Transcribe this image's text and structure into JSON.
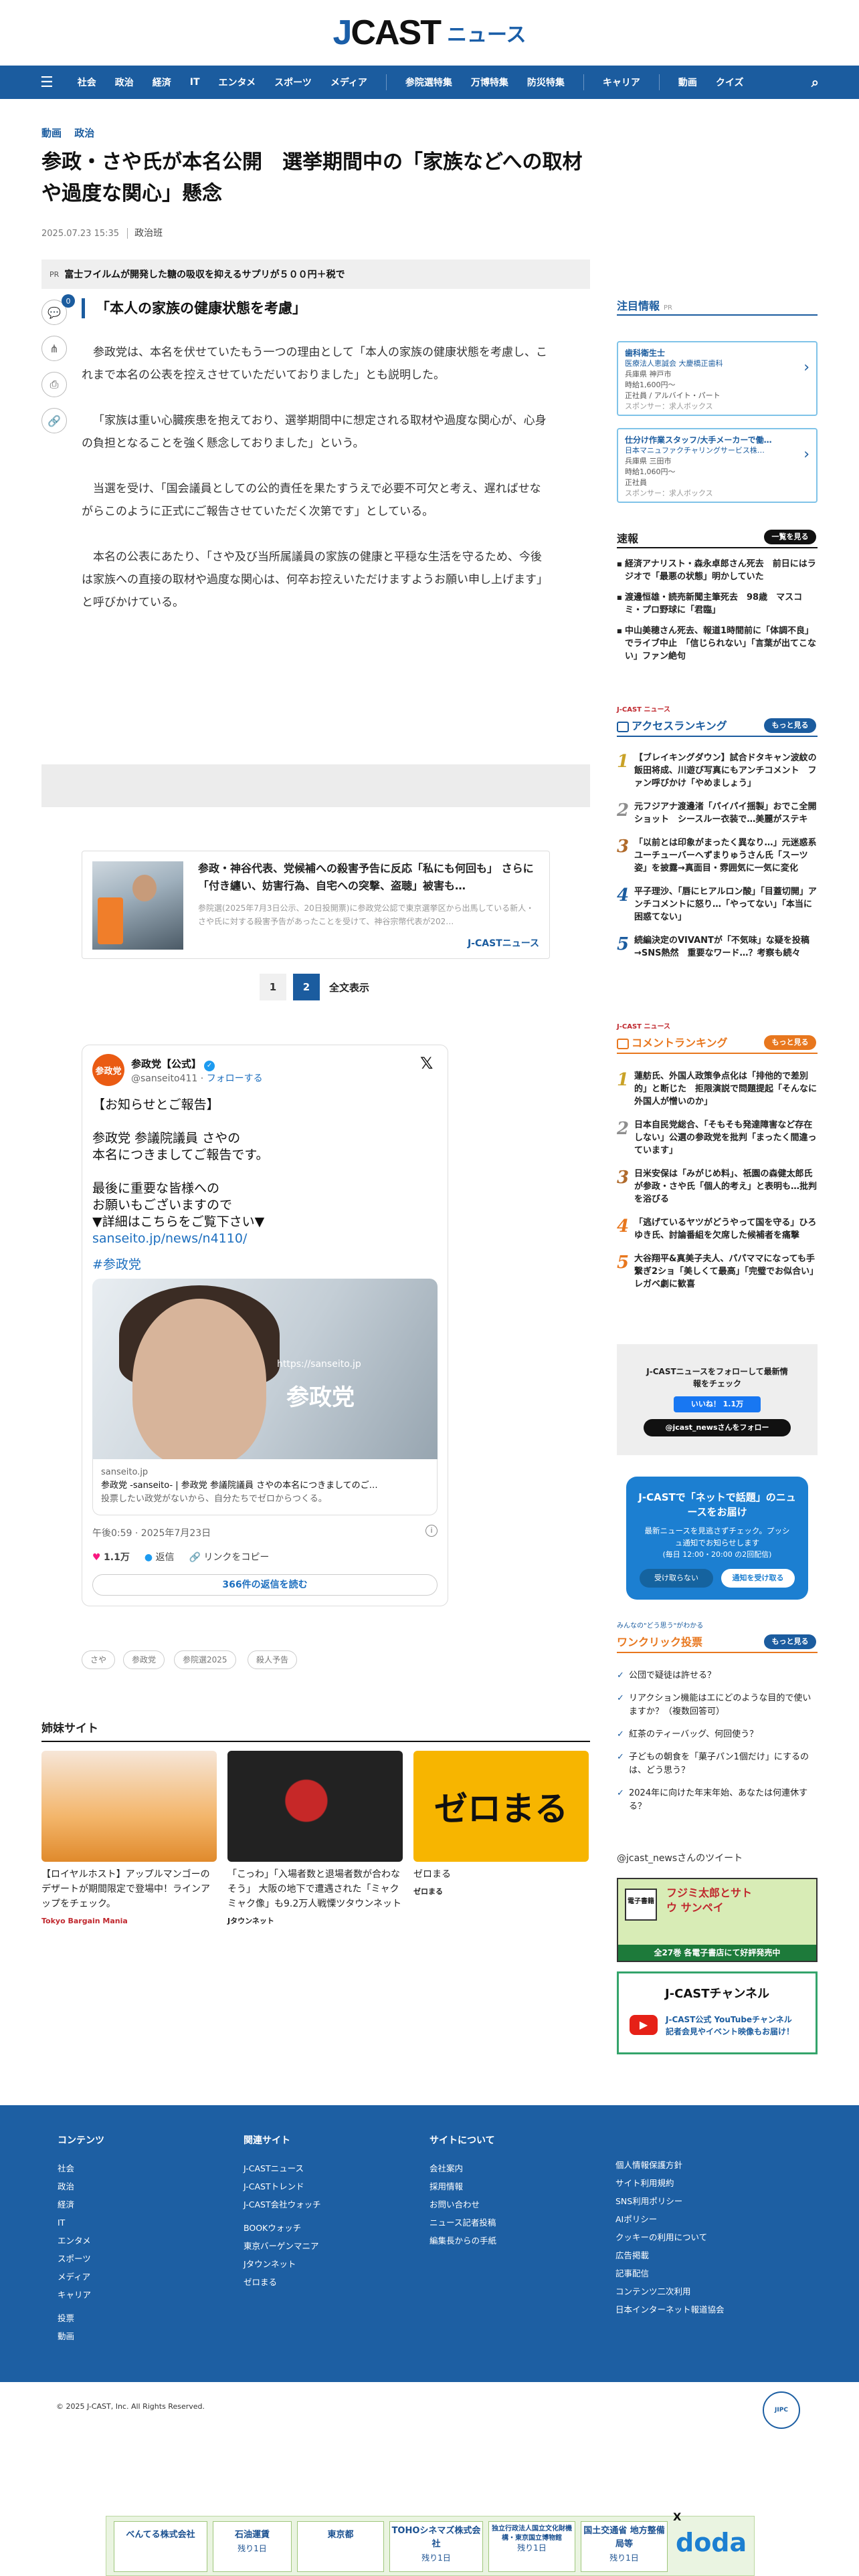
{
  "header": {
    "logo_j": "J",
    "logo_cast": "CAST",
    "logo_news": "ニュース"
  },
  "nav": {
    "items": [
      "社会",
      "政治",
      "経済",
      "IT",
      "エンタメ",
      "スポーツ",
      "メディア",
      "参院選特集",
      "万博特集",
      "防災特集",
      "キャリア",
      "動画",
      "クイズ"
    ]
  },
  "article": {
    "categories": [
      "動画",
      "政治"
    ],
    "title": "参政・さや氏が本名公開　選挙期間中の「家族などへの取材や過度な関心」懸念",
    "date": "2025.07.23 15:35",
    "byline": "政治班",
    "pr_label": "PR",
    "pr_text": "富士フイルムが開発した糖の吸収を抑えるサプリが５００円＋税で",
    "share_count": "0",
    "heading": "「本人の家族の健康状態を考慮」",
    "paragraphs": [
      "参政党は、本名を伏せていたもう一つの理由として「本人の家族の健康状態を考慮し、これまで本名の公表を控えさせていただいておりました」とも説明した。",
      "「家族は重い心臓疾患を抱えており、選挙期間中に想定される取材や過度な関心が、心身の負担となることを強く懸念しておりました」という。",
      "当選を受け、「国会議員としての公的責任を果たすうえで必要不可欠と考え、遅ればせながらこのように正式にご報告させていただく次第です」としている。",
      "本名の公表にあたり、「さや及び当所属議員の家族の健康と平穏な生活を守るため、今後は家族への直接の取材や過度な関心は、何卒お控えいただけますようお願い申し上げます」と呼びかけている。"
    ]
  },
  "related": {
    "title": "参政・神谷代表、党候補への殺害予告に反応「私にも何回も」 さらに「付き纏い、妨害行為、自宅への突撃、盗聴」被害も…",
    "summary": "参院選(2025年7月3日公示、20日投開票)に参政党公認で東京選挙区から出馬している新人・さや氏に対する殺害予告があったことを受けて、神谷宗幣代表が202…",
    "source": "J-CASTニュース"
  },
  "pager": {
    "p1": "1",
    "p2": "2",
    "all": "全文表示"
  },
  "tweet": {
    "avatar": "参政党",
    "name": "参政党【公式】",
    "handle": "@sanseito411",
    "follow": "フォローする",
    "lines": [
      "【お知らせとご報告】",
      "",
      "参政党 参議院議員 さやの",
      "本名につきましてご報告です。",
      "",
      "最後に重要な皆様への",
      "お願いもございますので",
      "▼詳細はこちらをご覧下さい▼"
    ],
    "link": "sanseito.jp/news/n4110/",
    "hashtag": "#参政党",
    "image_logo": "参政党",
    "image_url": "https://sanseito.jp",
    "card_domain": "sanseito.jp",
    "card_title": "参政党 -sanseito- | 参政党 参議院議員 さやの本名につきましてのご…",
    "card_desc": "投票したい政党がないから、自分たちでゼロからつくる。",
    "time": "午後0:59 · 2025年7月23日",
    "likes": "1.1万",
    "reply": "返信",
    "copy": "リンクをコピー",
    "more": "366件の返信を読む"
  },
  "tags": [
    "さや",
    "参政党",
    "参院選2025",
    "殺人予告"
  ],
  "sister": {
    "heading": "姉妹サイト",
    "items": [
      {
        "text": "【ロイヤルホスト】アップルマンゴーのデザートが期間限定で登場中！ラインアップをチェック。",
        "logo": "Tokyo Bargain Mania"
      },
      {
        "text": "「こっわ」「入場者数と退場者数が合わなそう」 大阪の地下で遭遇された「ミャクミャク像」も9.2万人戦慄ツタウンネット",
        "logo": "Jタウンネット"
      },
      {
        "text": "ゼロまる",
        "logo": "ゼロまる",
        "banner": "ゼロまる"
      }
    ]
  },
  "sidebar": {
    "attention": "注目情報",
    "pr": "PR",
    "jobs": [
      {
        "title": "歯科衛生士",
        "line1": "医療法人恵誠会 大慶橋正歯科",
        "line2": "兵庫県 神戸市",
        "line3": "時給1,600円〜",
        "line4": "正社員 / アルバイト・パート",
        "line5": "スポンサー：求人ボックス"
      },
      {
        "title": "仕分け作業スタッフ/大手メーカーで働…",
        "line1": "日本マニュファクチャリングサービス株…",
        "line2": "兵庫県 三田市",
        "line3": "時給1,060円〜",
        "line4": "正社員",
        "line5": "スポンサー：求人ボックス"
      }
    ],
    "flash_title": "速報",
    "flash_more": "一覧を見る",
    "flash": [
      "経済アナリスト・森永卓郎さん死去　前日にはラジオで「最悪の状態」明かしていた",
      "渡邊恒雄・読売新聞主筆死去　98歳　マスコミ・プロ野球に「君臨」",
      "中山美穂さん死去、報道1時間前に「体調不良」でライブ中止　「信じられない」「言葉が出てこない」ファン絶句"
    ],
    "brand": "J-CAST ニュース",
    "access_title": "アクセスランキング",
    "access_more": "もっと見る",
    "access": [
      "【ブレイキングダウン】試合ドタキャン波紋の飯田将成、川遊び写真にもアンチコメント　ファン呼びかけ「やめましょう」",
      "元フジアナ渡邊渚「パイパイ揺製」おでこ全開ショット　シースルー衣装で…美麗がステキ",
      "「以前とは印象がまったく異なり…」元迷惑系ユーチューバーへずまりゅうさん氏「スーツ姿」を披露→真面目・雰囲気に一気に変化",
      "平子理沙、「唇にヒアルロン酸」「目蓋切開」アンチコメントに怒り…「やってない」「本当に困惑てない」",
      "続編決定のVIVANTが「不気味」な疑を投稿→SNS熱然　重要なワード…？考察も続々"
    ],
    "comment_title": "コメントランキング",
    "comment_more": "もっと見る",
    "comment": [
      "蓮舫氏、外国人政策争点化は「排他的で差別的」と断じた　拒限演説で問題提起「そんなに外国人が憎いのか」",
      "日本自民党総合、「そもそも発達障害など存在しない」公選の参政党を批判「まったく間違っています」",
      "日米安保は「みがじめ料」、祇園の森健太郎氏が参政・さや氏「個人的考え」と表明も…批判を浴びる",
      "「逃げているヤツがどうやって国を守る」ひろゆき氏、討論番組を欠席した候補者を痛撃",
      "大谷翔平&真美子夫人、パパママになっても手繋ぎ2ショ「美しくて最高」「完璧でお似合い」レガベ劇に歓喜"
    ],
    "follow_text": "J-CASTニュースをフォローして最新情報をチェック",
    "like_btn": "いいね！ 1.1万",
    "x_btn": "@jcast_newsさんをフォロー",
    "push_title": "J-CASTで「ネットで話題」のニュースをお届け",
    "push_body": "最新ニュースを見逃さずチェック。プッシュ通知でお知らせします",
    "push_time": "(毎日 12:00・20:00 の2回配信)",
    "push_no": "受け取らない",
    "push_yes": "通知を受け取る",
    "poll_sub": "みんなの\"どう思う\"がわかる",
    "poll_title": "ワンクリック投票",
    "poll_more": "もっと見る",
    "poll": [
      "公団で疑徒は許せる？",
      "リアクション機能はエにどのような目的で使いますか？（複数回答可）",
      "紅茶のティーバッグ、何回使う？",
      "子どもの朝食を「菓子パン1個だけ」にするのは、どう思う？",
      "2024年に向けた年末年始、あなたは何連休する？"
    ],
    "tweets_label": "@jcast_newsさんのツイート",
    "manga_title": "フジミ太郎とサトウ サンペイ",
    "manga_sub": "全27巻 各電子書店にて好評発売中",
    "manga_tag": "電子書籍",
    "yt_title": "J-CASTチャンネル",
    "yt_sub": "J-CAST公式 YouTubeチャンネル",
    "yt_sub2": "記者会見やイベント映像もお届け！"
  },
  "footer": {
    "col1_h": "コンテンツ",
    "col1": [
      "社会",
      "政治",
      "経済",
      "IT",
      "エンタメ",
      "スポーツ",
      "メディア",
      "キャリア",
      "",
      "投票",
      "動画"
    ],
    "col2_h": "関連サイト",
    "col2": [
      "J-CASTニュース",
      "J-CASTトレンド",
      "J-CAST会社ウォッチ",
      "",
      "BOOKウォッチ",
      "東京バーゲンマニア",
      "Jタウンネット",
      "ゼロまる"
    ],
    "col3_h": "サイトについて",
    "col3": [
      "会社案内",
      "採用情報",
      "お問い合わせ",
      "ニュース記者投稿",
      "編集長からの手紙"
    ],
    "col4": [
      "個人情報保護方針",
      "サイト利用規約",
      "SNS利用ポリシー",
      "AIポリシー",
      "クッキーの利用について",
      "広告掲載",
      "記事配信",
      "コンテンツ二次利用",
      "日本インターネット報道協会"
    ],
    "copyright": "© 2025 J-CAST, Inc. All Rights Reserved.",
    "jcpc": "JIPC"
  },
  "bottom_ad": {
    "cells": [
      {
        "t": "べんてる株式会社",
        "s": ""
      },
      {
        "t": "石油運賃",
        "s": "残り1日"
      },
      {
        "t": "東京都",
        "s": ""
      },
      {
        "t": "TOHOシネマズ株式会社",
        "s": "残り1日"
      },
      {
        "t": "独立行政法人国立文化財機構・東京国立博物館",
        "s": "残り1日"
      },
      {
        "t": "国土交通省 地方整備局等",
        "s": "残り1日"
      }
    ],
    "brand": "doda",
    "close": "X"
  },
  "colors": {
    "brand": "#1b5c9f",
    "accent_orange": "#e8771e",
    "footer": "#1d5fa3"
  }
}
